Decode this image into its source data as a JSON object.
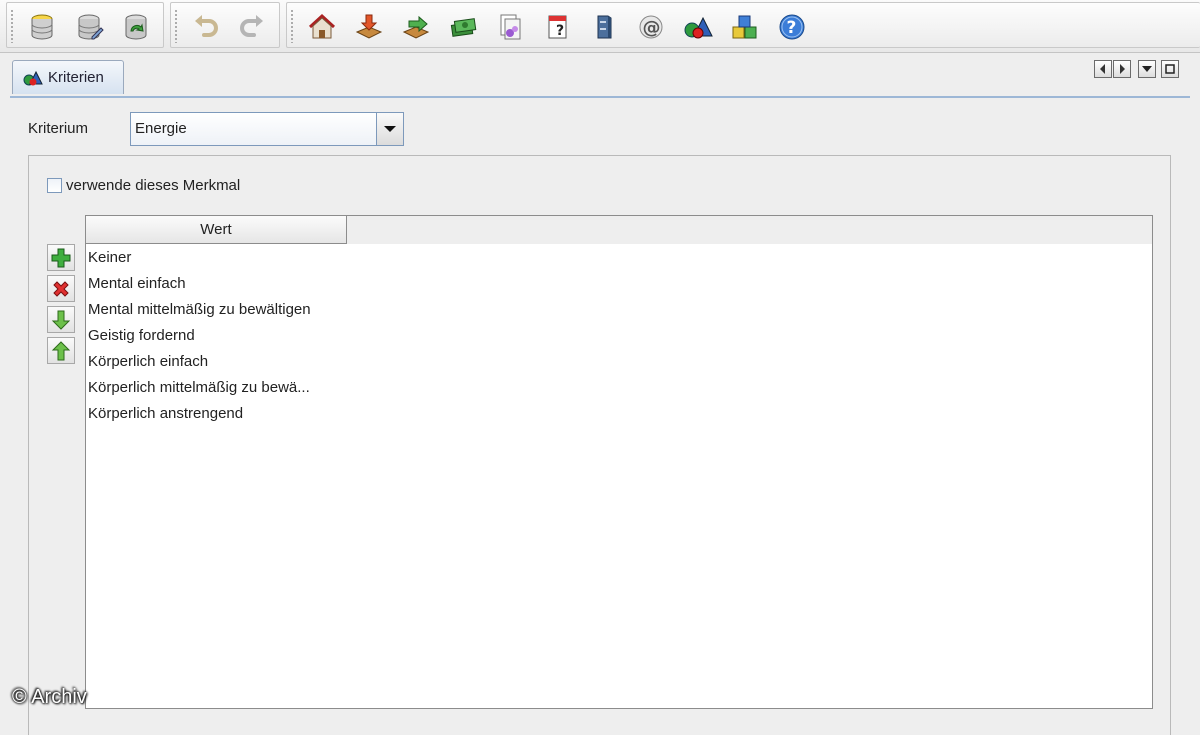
{
  "toolbar": {
    "groups": [
      {
        "name": "database",
        "buttons": [
          "database-icon",
          "database-edit-icon",
          "database-refresh-icon"
        ]
      },
      {
        "name": "history",
        "buttons": [
          "undo-icon",
          "redo-icon"
        ]
      },
      {
        "name": "main",
        "buttons": [
          "home-icon",
          "import-icon",
          "export-icon",
          "money-icon",
          "documents-icon",
          "calendar-help-icon",
          "cabinet-icon",
          "at-sign-icon",
          "shapes-icon",
          "cubes-icon",
          "help-icon"
        ]
      }
    ]
  },
  "tab": {
    "label": "Kriterien",
    "icon": "shapes-icon"
  },
  "tab_controls": [
    "scroll-left-icon",
    "scroll-right-icon",
    "dropdown-icon",
    "maximize-icon"
  ],
  "criterion": {
    "label": "Kriterium",
    "selected": "Energie"
  },
  "use_feature": {
    "label": "verwende dieses Merkmal",
    "checked": false
  },
  "side_buttons": [
    "add-icon",
    "delete-icon",
    "move-down-icon",
    "move-up-icon"
  ],
  "table": {
    "columns": [
      "Wert"
    ],
    "rows": [
      "Keiner",
      "Mental einfach",
      "Mental mittelmäßig zu bewältigen",
      "Geistig fordernd",
      "Körperlich einfach",
      "Körperlich mittelmäßig zu bewä...",
      "Körperlich anstrengend"
    ]
  },
  "watermark": "© Archiv",
  "colors": {
    "tab_accent": "#9db7d6",
    "combo_border": "#7d99bb"
  }
}
